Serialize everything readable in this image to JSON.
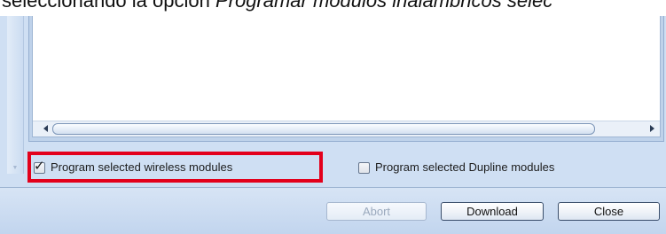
{
  "document": {
    "text_prefix": "seleccionando la opción ",
    "text_italic": "Programar módulos inalámbricos selec"
  },
  "options": {
    "wireless": {
      "label": "Program selected wireless modules",
      "checked": true
    },
    "dupline": {
      "label": "Program selected Dupline modules",
      "checked": false
    }
  },
  "buttons": {
    "abort": {
      "label": "Abort",
      "enabled": false
    },
    "download": {
      "label": "Download",
      "enabled": true
    },
    "close": {
      "label": "Close",
      "enabled": true
    }
  },
  "colors": {
    "highlight": "#e3001b",
    "dialog_background": "#cfdff3"
  }
}
